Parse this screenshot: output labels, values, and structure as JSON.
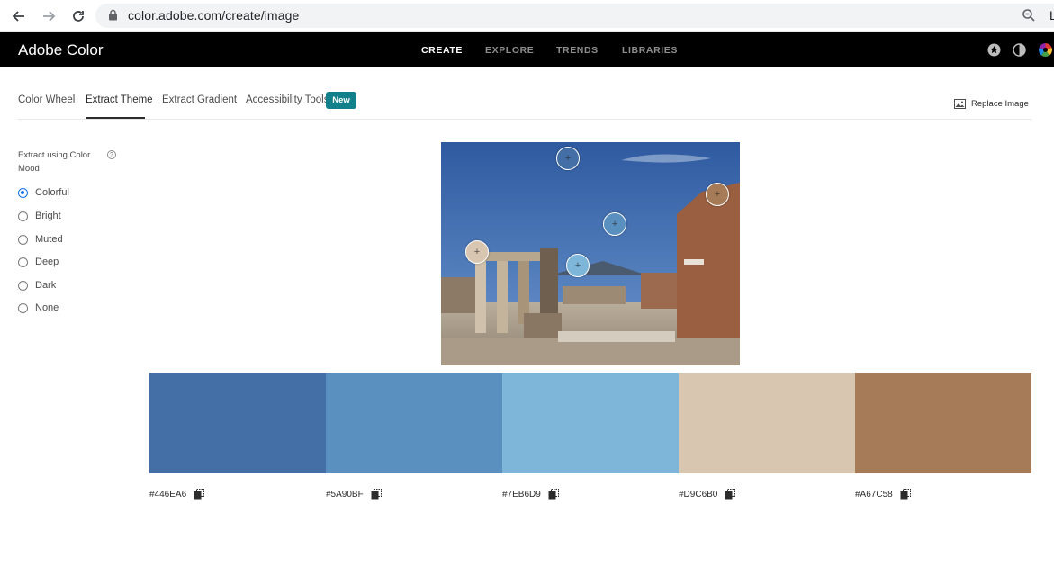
{
  "browser": {
    "url": "color.adobe.com/create/image"
  },
  "app": {
    "brand": "Adobe Color",
    "nav": [
      "CREATE",
      "EXPLORE",
      "TRENDS",
      "LIBRARIES"
    ],
    "active_nav": "CREATE"
  },
  "tabs": {
    "items": [
      "Color Wheel",
      "Extract Theme",
      "Extract Gradient",
      "Accessibility Tools"
    ],
    "active": "Extract Theme",
    "badge": "New",
    "replace_image": "Replace Image"
  },
  "mood": {
    "title": "Extract using Color Mood",
    "help": "?",
    "options": [
      "Colorful",
      "Bright",
      "Muted",
      "Deep",
      "Dark",
      "None"
    ],
    "selected": "Colorful"
  },
  "theme": {
    "swatches": [
      {
        "hex": "#446EA6"
      },
      {
        "hex": "#5A90BF"
      },
      {
        "hex": "#7EB6D9"
      },
      {
        "hex": "#D9C6B0"
      },
      {
        "hex": "#A67C58"
      }
    ]
  },
  "icons": {
    "back": "back-arrow-icon",
    "forward": "forward-arrow-icon",
    "reload": "reload-icon",
    "lock": "lock-icon",
    "zoom": "zoom-icon",
    "replace": "image-icon",
    "copy": "copy-icon"
  }
}
